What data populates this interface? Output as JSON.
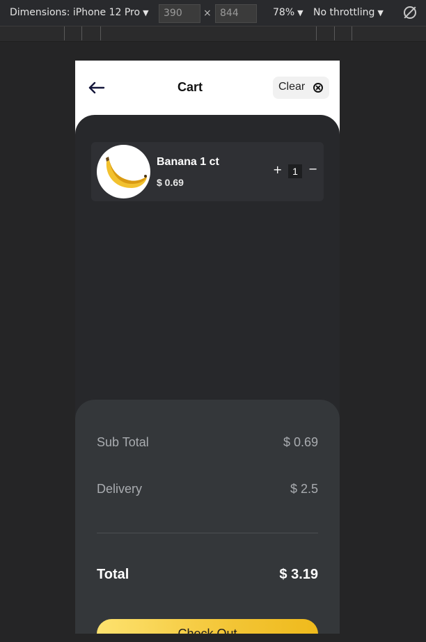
{
  "devtools": {
    "device_label": "Dimensions: iPhone 12 Pro",
    "width_value": "390",
    "height_value": "844",
    "times": "×",
    "zoom": "78%",
    "throttle": "No throttling",
    "caret": "▼"
  },
  "header": {
    "title": "Cart",
    "clear_label": "Clear"
  },
  "cart": {
    "items": [
      {
        "name": "Banana 1 ct",
        "price": "$ 0.69",
        "quantity": "1",
        "plus": "+",
        "minus": "−"
      }
    ]
  },
  "summary": {
    "subtotal_label": "Sub Total",
    "subtotal_value": "$ 0.69",
    "delivery_label": "Delivery",
    "delivery_value": "$ 2.5",
    "total_label": "Total",
    "total_value": "$ 3.19"
  },
  "checkout_label": "Check Out",
  "colors": {
    "accent_yellow": "#f3c536",
    "dark_bg": "#27282b",
    "summary_bg": "#34373a"
  }
}
